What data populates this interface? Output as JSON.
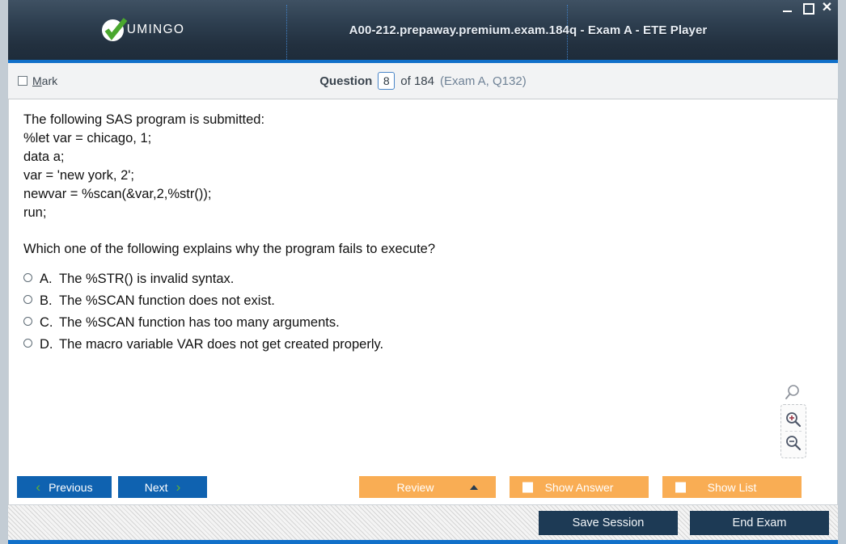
{
  "window": {
    "title": "A00-212.prepaway.premium.exam.184q - Exam A - ETE Player",
    "brand": "UMINGO",
    "controls": {
      "minimize": "–",
      "maximize": "□",
      "close": "✕"
    }
  },
  "header": {
    "mark_label_prefix": "M",
    "mark_label_rest": "ark",
    "question_word": "Question",
    "question_number": "8",
    "of_text": "of 184",
    "exam_ref": "(Exam A, Q132)"
  },
  "question": {
    "code_lines": [
      "The following SAS program is submitted:",
      "%let var = chicago, 1;",
      "data a;",
      "var = 'new york, 2';",
      "newvar = %scan(&var,2,%str());",
      "run;"
    ],
    "prompt": "Which one of the following explains why the program fails to execute?",
    "options": [
      {
        "letter": "A.",
        "text": "The %STR() is invalid syntax."
      },
      {
        "letter": "B.",
        "text": "The %SCAN function does not exist."
      },
      {
        "letter": "C.",
        "text": "The %SCAN function has too many arguments."
      },
      {
        "letter": "D.",
        "text": "The macro variable VAR does not get created properly."
      }
    ]
  },
  "tools": {
    "magnifier": "magnifier-icon",
    "zoom_in": "zoom-in-icon",
    "zoom_out": "zoom-out-icon"
  },
  "actions": {
    "previous": "Previous",
    "next": "Next",
    "review": "Review",
    "show_answer": "Show Answer",
    "show_list": "Show List",
    "prev_chevron": "‹",
    "next_chevron": "›"
  },
  "status": {
    "save_session": "Save Session",
    "end_exam": "End Exam"
  },
  "colors": {
    "accent_blue": "#1170c9",
    "button_blue": "#0f62b0",
    "orange": "#f9ad54",
    "navy": "#1d3a55",
    "green": "#61b330"
  }
}
